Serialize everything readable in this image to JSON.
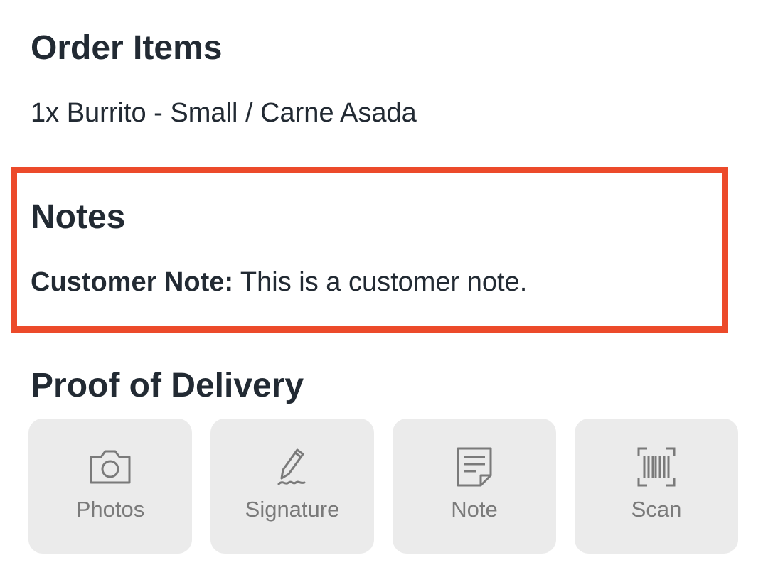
{
  "order_items": {
    "title": "Order Items",
    "items": [
      "1x Burrito - Small / Carne Asada"
    ]
  },
  "notes": {
    "title": "Notes",
    "customer_note_label": "Customer Note:",
    "customer_note_text": " This is a customer note.",
    "highlight_color": "#ec4a2a"
  },
  "proof_of_delivery": {
    "title": "Proof of Delivery",
    "buttons": [
      {
        "label": "Photos",
        "icon": "camera-icon"
      },
      {
        "label": "Signature",
        "icon": "pen-signature-icon"
      },
      {
        "label": "Note",
        "icon": "note-icon"
      },
      {
        "label": "Scan",
        "icon": "barcode-scan-icon"
      }
    ]
  },
  "colors": {
    "text": "#222a33",
    "button_bg": "#ebebeb",
    "button_text": "#7a7a7a"
  }
}
